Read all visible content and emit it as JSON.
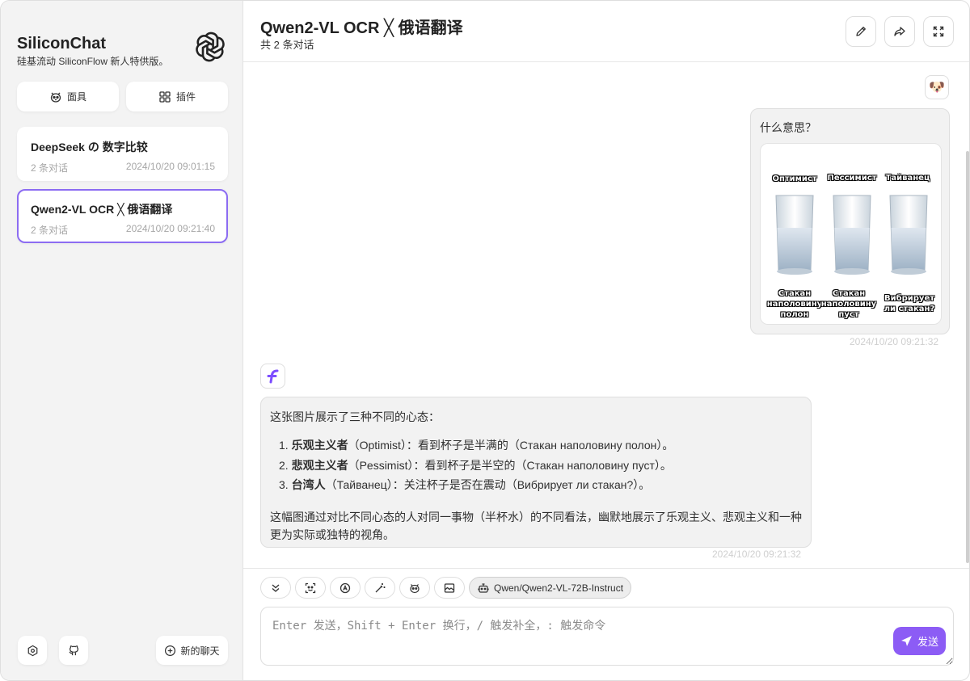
{
  "sidebar": {
    "brand_title": "SiliconChat",
    "brand_subtitle": "硅基流动 SiliconFlow 新人特供版。",
    "mask_button": "面具",
    "plugin_button": "插件",
    "chats": [
      {
        "title": "DeepSeek の 数字比较",
        "count": "2 条对话",
        "date": "2024/10/20 09:01:15",
        "active": false
      },
      {
        "title": "Qwen2-VL OCR ╳ 俄语翻译",
        "count": "2 条对话",
        "date": "2024/10/20 09:21:40",
        "active": true
      }
    ],
    "new_chat_label": "新的聊天"
  },
  "header": {
    "title": "Qwen2-VL OCR ╳ 俄语翻译",
    "subtitle": "共 2 条对话"
  },
  "messages": {
    "user": {
      "avatar": "🐶",
      "question": "什么意思？",
      "image": {
        "glasses": [
          {
            "top_label": "Оптимист",
            "bottom_label": "Стакан наполовину полон"
          },
          {
            "top_label": "Пессимист",
            "bottom_label": "Стакан наполовину пуст"
          },
          {
            "top_label": "Тайванец",
            "bottom_label": "Вибрирует ли стакан?"
          }
        ]
      },
      "time": "2024/10/20 09:21:32"
    },
    "bot": {
      "intro": "这张图片展示了三种不同的心态：",
      "items": [
        {
          "num": "1.",
          "bold": "乐观主义者",
          "rest": "（Optimist）：看到杯子是半满的（Стакан наполовину полон）。"
        },
        {
          "num": "2.",
          "bold": "悲观主义者",
          "rest": "（Pessimist）：看到杯子是半空的（Стакан наполовину пуст）。"
        },
        {
          "num": "3.",
          "bold": "台湾人",
          "rest": "（Тайванец）：关注杯子是否在震动（Вибрирует ли стакан?）。"
        }
      ],
      "conclusion": "这幅图通过对比不同心态的人对同一事物（半杯水）的不同看法，幽默地展示了乐观主义、悲观主义和一种更为实际或独特的视角。",
      "time": "2024/10/20 09:21:32"
    }
  },
  "input": {
    "model": "Qwen/Qwen2-VL-72B-Instruct",
    "placeholder": "Enter 发送，Shift + Enter 换行，/ 触发补全，: 触发命令",
    "send_label": "发送"
  },
  "colors": {
    "accent": "#8c5cf5",
    "active_border": "#8c6cf2",
    "bot_logo": "#7c4dff"
  }
}
